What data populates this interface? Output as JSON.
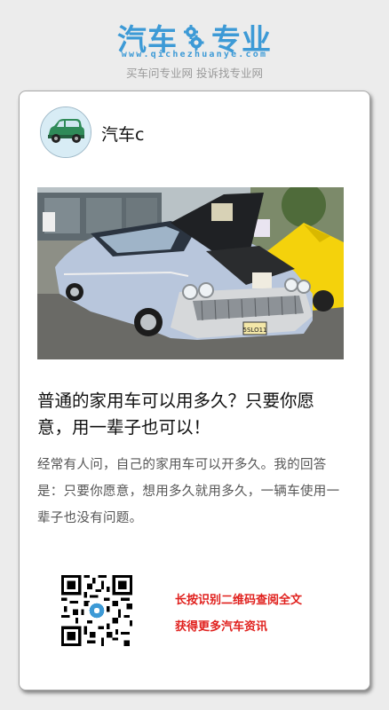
{
  "brand": {
    "logo_left": "汽车",
    "logo_right": "专业",
    "url": "www.qichezhuanye.com",
    "tagline": "买车问专业网 投诉找专业网",
    "accent_color": "#3d9ad6"
  },
  "post": {
    "author": "汽车c",
    "avatar_icon": "green-car-icon",
    "photo_icon": "vintage-car-photo",
    "license_plate": "5SLO11",
    "title": "普通的家用车可以用多久？只要你愿意，用一辈子也可以！",
    "summary": "经常有人问，自己的家用车可以开多久。我的回答是：只要你愿意，想用多久就用多久，一辆车使用一辈子也没有问题。"
  },
  "share": {
    "qr_icon": "qr-code-icon",
    "line1": "长按识别二维码查阅全文",
    "line2": "获得更多汽车资讯",
    "cta_color": "#e0201d"
  }
}
